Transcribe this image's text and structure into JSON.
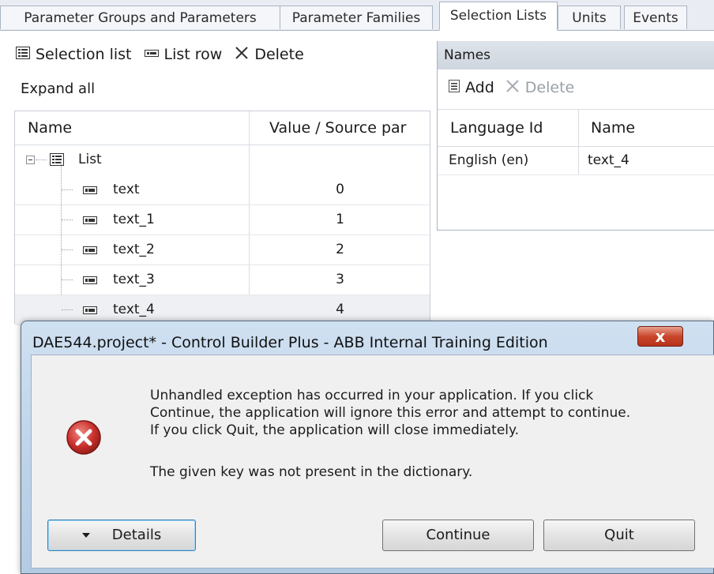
{
  "tabs": [
    {
      "label": "Parameter Groups and Parameters"
    },
    {
      "label": "Parameter Families"
    },
    {
      "label": "Selection Lists",
      "active": true
    },
    {
      "label": "Units"
    },
    {
      "label": "Events"
    }
  ],
  "left_toolbar": {
    "selection_list": "Selection list",
    "list_row": "List row",
    "delete": "Delete",
    "expand_all": "Expand all"
  },
  "left_grid": {
    "columns": [
      "Name",
      "Value / Source par"
    ],
    "root": {
      "name": "List"
    },
    "rows": [
      {
        "name": "text",
        "value": "0"
      },
      {
        "name": "text_1",
        "value": "1"
      },
      {
        "name": "text_2",
        "value": "2"
      },
      {
        "name": "text_3",
        "value": "3"
      },
      {
        "name": "text_4",
        "value": "4"
      }
    ]
  },
  "names_panel": {
    "header": "Names",
    "add": "Add",
    "delete": "Delete",
    "columns": [
      "Language Id",
      "Name"
    ],
    "rows": [
      {
        "language": "English (en)",
        "name": "text_4"
      }
    ]
  },
  "dialog": {
    "title": "DAE544.project* - Control Builder Plus - ABB Internal Training Edition",
    "close": "x",
    "message_lines": [
      "Unhandled exception has occurred in your application. If you click",
      "Continue, the application will ignore this error and attempt to continue.",
      "If you click Quit, the application will close immediately."
    ],
    "detail": "The given key was not present in the dictionary.",
    "buttons": {
      "details": "Details",
      "continue": "Continue",
      "quit": "Quit"
    }
  },
  "colors": {
    "error_red": "#c9302c",
    "dialog_frame": "#bcd2e9",
    "close_red": "#c9462b"
  },
  "icons": {
    "selection_list": "list-icon",
    "list_row": "list-row-icon",
    "delete": "x-icon",
    "error": "error-icon"
  }
}
